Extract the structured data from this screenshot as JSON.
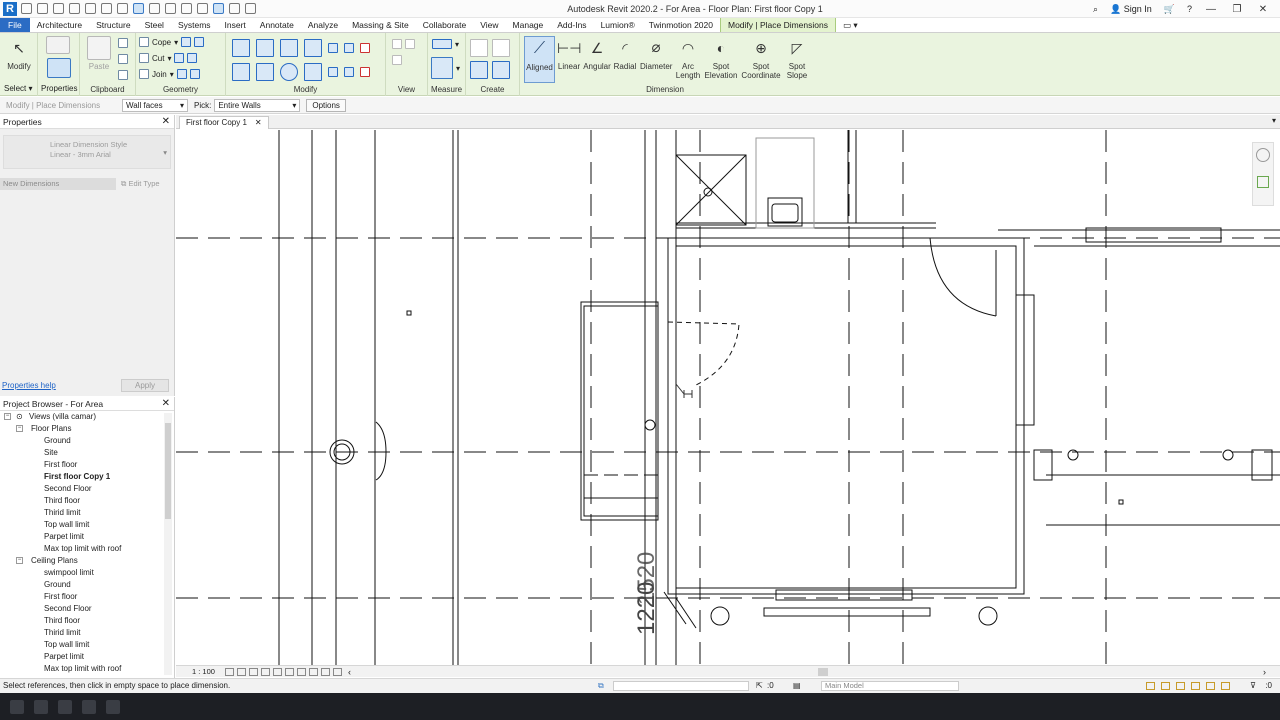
{
  "app": {
    "title": "Autodesk Revit 2020.2 - For Area - Floor Plan: First floor Copy 1",
    "logo": "R",
    "sign_in": "Sign In"
  },
  "tabs": [
    "File",
    "Architecture",
    "Structure",
    "Steel",
    "Systems",
    "Insert",
    "Annotate",
    "Analyze",
    "Massing & Site",
    "Collaborate",
    "View",
    "Manage",
    "Add-Ins",
    "Lumion®",
    "Twinmotion 2020",
    "Modify | Place Dimensions"
  ],
  "ribbon": {
    "modify_label": "Modify",
    "select_label": "Select",
    "properties_label": "Properties",
    "paste_label": "Paste",
    "clipboard_label": "Clipboard",
    "geometry": {
      "cope": "Cope",
      "cut": "Cut",
      "join": "Join",
      "label": "Geometry"
    },
    "modify_panel_label": "Modify",
    "view_label": "View",
    "measure_label": "Measure",
    "create_label": "Create",
    "dimension": {
      "aligned": "Aligned",
      "linear": "Linear",
      "angular": "Angular",
      "radial": "Radial",
      "diameter": "Diameter",
      "arc_length_1": "Arc",
      "arc_length_2": "Length",
      "spot_elev_1": "Spot",
      "spot_elev_2": "Elevation",
      "spot_coord_1": "Spot",
      "spot_coord_2": "Coordinate",
      "spot_slope_1": "Spot",
      "spot_slope_2": "Slope",
      "label": "Dimension"
    }
  },
  "options_bar": {
    "context": "Modify | Place Dimensions",
    "reference": "Wall faces",
    "pick_label": "Pick:",
    "pick_value": "Entire Walls",
    "options_button": "Options"
  },
  "properties": {
    "title": "Properties",
    "type_line1": "Linear Dimension Style",
    "type_line2": "Linear - 3mm Arial",
    "instance": "New Dimensions",
    "edit_type": "Edit Type",
    "help": "Properties help",
    "apply": "Apply"
  },
  "project_browser": {
    "title": "Project Browser - For Area",
    "root": "Views (villa camar)",
    "floor_plans_label": "Floor Plans",
    "floor_plans": [
      "Ground",
      "Site",
      "First floor",
      "First floor Copy 1",
      "Second Floor",
      "Third floor",
      "Thirid limit",
      "Top wall limit",
      "Parpet limit",
      "Max top limit with roof"
    ],
    "ceiling_plans_label": "Ceiling Plans",
    "ceiling_plans": [
      "swimpool limit",
      "Ground",
      "First floor",
      "Second Floor",
      "Third floor",
      "Thirid limit",
      "Top wall limit",
      "Parpet limit",
      "Max top limit with roof"
    ],
    "selected": "First floor Copy 1"
  },
  "view_tab": {
    "label": "First floor Copy 1"
  },
  "canvas": {
    "dim_text_a": "1220",
    "dim_text_b": "1520"
  },
  "view_bar": {
    "scale": "1 : 100"
  },
  "status": {
    "message": "Select references, then click in empty space to place dimension.",
    "selection_count": ":0",
    "model": "Main Model",
    "filter_count": ":0"
  },
  "colors": {
    "file_tab": "#2b6cc4",
    "context_tab": "#e4f3cf",
    "ribbon_bg": "#eaf4df"
  }
}
